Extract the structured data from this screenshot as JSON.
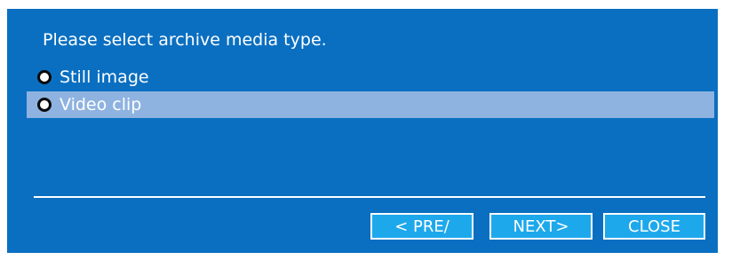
{
  "dialog": {
    "prompt": "Please select archive media type.",
    "options": [
      {
        "label": "Still image",
        "selected": false
      },
      {
        "label": "Video clip",
        "selected": true
      }
    ],
    "buttons": {
      "pre": "< PRE/",
      "next": "NEXT>",
      "close": "CLOSE"
    }
  },
  "colors": {
    "dialog_background": "#0a6fc1",
    "selected_row": "#8fb3e0",
    "button_fill": "#1ea8ec",
    "text": "#ffffff"
  }
}
